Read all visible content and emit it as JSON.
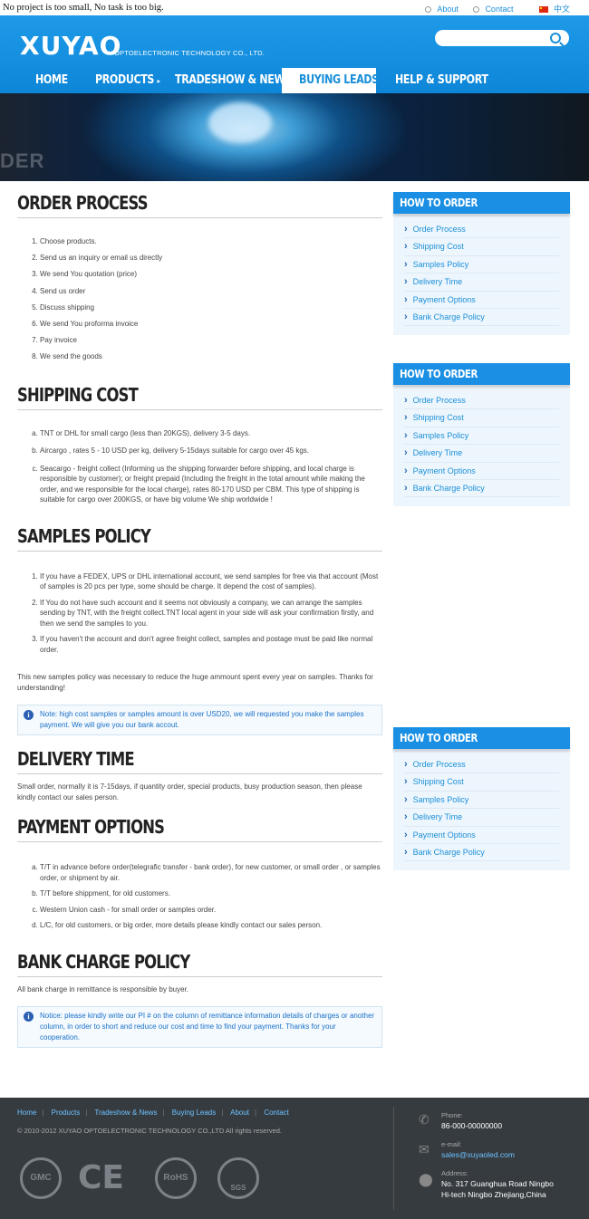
{
  "topbar": {
    "slogan": "No project is too small, No task is too big.",
    "about": "About",
    "contact": "Contact",
    "lang": "中文"
  },
  "header": {
    "logo": "XUYAO",
    "logo_sub": "OPTOELECTRONIC TECHNOLOGY CO., LTD."
  },
  "nav": {
    "items": [
      {
        "label": "HOME"
      },
      {
        "label": "PRODUCTS"
      },
      {
        "label": "TRADESHOW & NEWS"
      },
      {
        "label": "BUYING LEADS"
      },
      {
        "label": "HELP & SUPPORT"
      }
    ]
  },
  "banner": {
    "text": "DER"
  },
  "sections": {
    "order_process": {
      "title": "ORDER PROCESS",
      "items": [
        "Choose products.",
        "Send us an inquiry or email us directly",
        "We send You quotation (price)",
        "Send us order",
        "Discuss shipping",
        "We send You proforma invoice",
        "Pay invoice",
        "We send the goods"
      ]
    },
    "shipping_cost": {
      "title": "SHIPPING COST",
      "items": [
        "TNT or DHL for small cargo (less than 20KGS), delivery 3-5 days.",
        "Aircargo , rates 5 - 10 USD per kg, delivery 5-15days suitable for cargo over 45 kgs.",
        "Seacargo - freight collect (Informing us the shipping forwarder before shipping, and local charge is responsible by customer); or freight prepaid (Including the freight in the total amount while making the order, and we responsible for the local charge), rates 80-170 USD per CBM. This type of shipping is suitable for cargo over 200KGS, or have big volume We ship worldwide !"
      ]
    },
    "samples_policy": {
      "title": "SAMPLES POLICY",
      "items": [
        "If you have a FEDEX, UPS or DHL international account, we send samples for free via that account (Most of samples is 20 pcs per type, some should be charge. It depend the cost of samples).",
        "If You do not have such account and it seems not obviously a company, we can arrange the samples sending by TNT, with the freight collect.TNT local agent in your side will ask your confirmation firstly, and then we send the samples to you.",
        "If you haven't the account and don't agree freight collect, samples and postage must be paid like normal order."
      ],
      "paragraph": "This new samples policy was necessary to reduce the huge ammount spent every year on samples. Thanks for understanding!",
      "note": "Note: high cost samples or samples amount is over USD20, we will requested you make the samples payment. We will give you our bank accout."
    },
    "delivery_time": {
      "title": "DELIVERY TIME",
      "paragraph": "Small order, normally it is 7-15days, if quantity order, special products, busy production season, then please kindly contact our sales person."
    },
    "payment_options": {
      "title": "PAYMENT OPTIONS",
      "items": [
        "T/T in advance before order(telegrafic transfer - bank order), for new customer, or small order , or samples order, or shipment by air.",
        "T/T before shippment, for old customers.",
        "Western Union cash - for small order or samples order.",
        "L/C, for old customers, or big order, more details please kindly contact our sales person."
      ]
    },
    "bank_charge": {
      "title": "BANK CHARGE POLICY",
      "paragraph": "All bank charge in remittance is responsible by buyer.",
      "note": "Notice: please kindly write our PI # on the column of remittance information details of charges or another column, in order to short and reduce our cost and time to find your payment. Thanks for your cooperation."
    }
  },
  "sidebar": {
    "title": "HOW TO ORDER",
    "links": [
      "Order Process",
      "Shipping Cost",
      "Samples Policy",
      "Delivery Time",
      "Payment Options",
      "Bank Charge Policy"
    ]
  },
  "footer": {
    "links": [
      "Home",
      "Products",
      "Tradeshow & News",
      "Buying Leads",
      "About",
      "Contact"
    ],
    "copyright": "© 2010-2012 XUYAO OPTOELECTRONIC TECHNOLOGY CO.,LTD All rights reserved.",
    "phone_label": "Phone:",
    "phone": "86-000-00000000",
    "email_label": "e-mail:",
    "email": "sales@xuyaoled.com",
    "address_label": "Address:",
    "address_line1": "No. 317 Guanghua Road Ningbo",
    "address_line2": "Hi-tech Ningbo Zhejiang,China",
    "badges": [
      "GMC",
      "CE",
      "RoHS",
      "SGS"
    ]
  }
}
